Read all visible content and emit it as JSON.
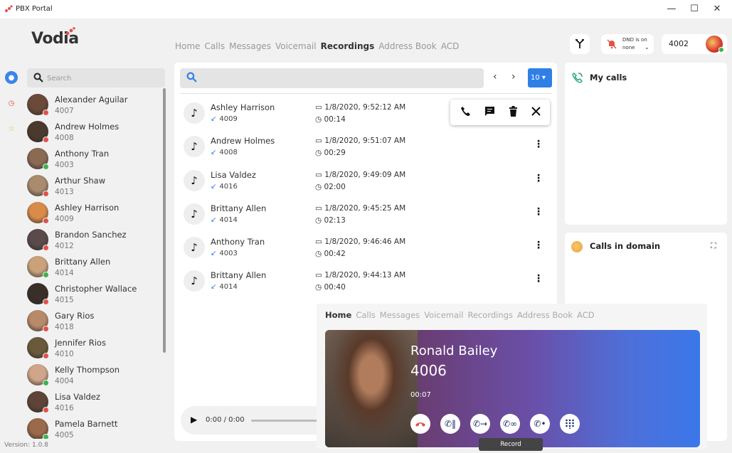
{
  "window": {
    "title": "PBX Portal",
    "minimize_glyph": "—",
    "maximize_glyph": "☐",
    "close_glyph": "✕"
  },
  "brand": {
    "logo_text": "Vodia"
  },
  "top_nav": {
    "items": [
      "Home",
      "Calls",
      "Messages",
      "Voicemail",
      "Recordings",
      "Address Book",
      "ACD"
    ],
    "active": "Recordings"
  },
  "header": {
    "dnd_label": "DND is on",
    "dnd_value": "none",
    "extension": "4002"
  },
  "sidebar": {
    "search_placeholder": "Search",
    "version": "Version: 1.0.8",
    "contacts": [
      {
        "name": "Alexander Aguilar",
        "ext": "4007",
        "status": "busy"
      },
      {
        "name": "Andrew Holmes",
        "ext": "4008",
        "status": "busy"
      },
      {
        "name": "Anthony Tran",
        "ext": "4003",
        "status": "available"
      },
      {
        "name": "Arthur Shaw",
        "ext": "4013",
        "status": "busy"
      },
      {
        "name": "Ashley Harrison",
        "ext": "4009",
        "status": "busy"
      },
      {
        "name": "Brandon Sanchez",
        "ext": "4012",
        "status": "busy"
      },
      {
        "name": "Brittany Allen",
        "ext": "4014",
        "status": "available"
      },
      {
        "name": "Christopher Wallace",
        "ext": "4015",
        "status": "busy"
      },
      {
        "name": "Gary Rios",
        "ext": "4018",
        "status": "busy"
      },
      {
        "name": "Jennifer Rios",
        "ext": "4010",
        "status": "busy"
      },
      {
        "name": "Kelly Thompson",
        "ext": "4004",
        "status": "available"
      },
      {
        "name": "Lisa Valdez",
        "ext": "4016",
        "status": "busy"
      },
      {
        "name": "Pamela Barnett",
        "ext": "4005",
        "status": "available"
      }
    ]
  },
  "recordings": {
    "page_size": "10",
    "items": [
      {
        "name": "Ashley Harrison",
        "ext": "4009",
        "date": "1/8/2020, 9:52:12 AM",
        "duration": "00:14"
      },
      {
        "name": "Andrew Holmes",
        "ext": "4008",
        "date": "1/8/2020, 9:51:07 AM",
        "duration": "00:29"
      },
      {
        "name": "Lisa Valdez",
        "ext": "4016",
        "date": "1/8/2020, 9:49:09 AM",
        "duration": "02:00"
      },
      {
        "name": "Brittany Allen",
        "ext": "4014",
        "date": "1/8/2020, 9:45:25 AM",
        "duration": "02:13"
      },
      {
        "name": "Anthony Tran",
        "ext": "4003",
        "date": "1/8/2020, 9:46:46 AM",
        "duration": "00:42"
      },
      {
        "name": "Brittany Allen",
        "ext": "4014",
        "date": "1/8/2020, 9:44:13 AM",
        "duration": "00:40"
      }
    ],
    "player_time": "0:00 / 0:00"
  },
  "panels": {
    "my_calls": "My calls",
    "calls_in_domain": "Calls in domain"
  },
  "call_window": {
    "nav": [
      "Home",
      "Calls",
      "Messages",
      "Voicemail",
      "Recordings",
      "Address Book",
      "ACD"
    ],
    "active": "Home",
    "name": "Ronald Bailey",
    "number": "4006",
    "timer": "00:07",
    "tooltip": "Record"
  },
  "colors": {
    "accent": "#2f7fe6",
    "available": "#3bb54a",
    "busy": "#e0524a",
    "hangup": "#e0524a"
  }
}
